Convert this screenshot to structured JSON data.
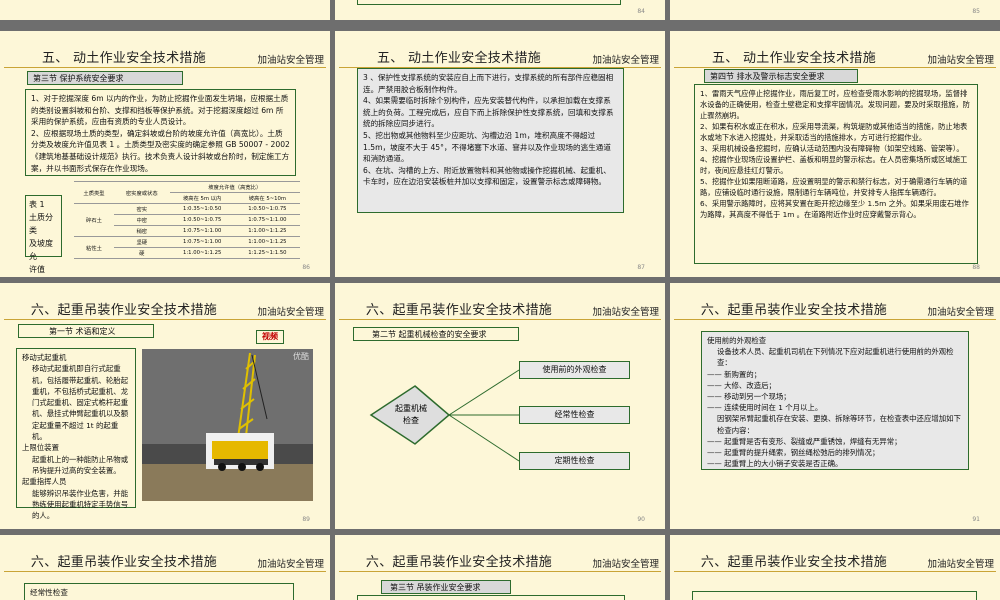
{
  "brand": "加油站安全管理",
  "top_strip": {
    "page_84": "84",
    "page_85": "85"
  },
  "slide_86": {
    "title": "五、 动土作业安全技术措施",
    "section": "第三节  保护系统安全要求",
    "text": [
      "1、对于挖掘深度 6m 以内的作业，为防止挖掘作业面发生坍塌，应根据土质的类别设置斜坡和台阶、支撑和挡板等保护系统。对于挖掘深度超过 6m 所采用的保护系统，应由有资质的专业人员设计。",
      "2、应根据现场土质的类型，确定斜坡或台阶的坡度允许值（高宽比）。土质分类及坡度允许值见表 1 。土质类型及密实度的确定参照 GB 50007 - 2002《建筑地基基础设计规范》执行。技术负责人设计斜坡或台阶时，制定施工方案，并以书面形式保存在作业现场。"
    ],
    "table_caption": [
      "表  1",
      "土质分类",
      "及坡度允",
      "许值"
    ],
    "table": {
      "h_type": "土质类型",
      "h_density": "密实度或状态",
      "h_slope": "坡度允许值（高宽比）",
      "h_d5": "坡高在 5m 以内",
      "h_d10": "坡高在 5~10m",
      "rows": [
        {
          "type": "碎石土",
          "state": "密实",
          "a": "1:0.35~1:0.50",
          "b": "1:0.50~1:0.75"
        },
        {
          "type": "",
          "state": "中密",
          "a": "1:0.50~1:0.75",
          "b": "1:0.75~1:1.00"
        },
        {
          "type": "",
          "state": "稍密",
          "a": "1:0.75~1:1.00",
          "b": "1:1.00~1:1.25"
        },
        {
          "type": "粘性土",
          "state": "坚硬",
          "a": "1:0.75~1:1.00",
          "b": "1:1.00~1:1.25"
        },
        {
          "type": "",
          "state": "硬",
          "a": "1:1.00~1:1.25",
          "b": "1:1.25~1:1.50"
        }
      ]
    },
    "page": "86"
  },
  "slide_87": {
    "title": "五、 动土作业安全技术措施",
    "text": [
      "3 、保护性支撑系统的安装应自上而下进行，支撑系统的所有部件应稳固相连。严禁用胶合板制作构件。",
      "4、如果需要临时拆除个别构件，应先安装替代构件，以承担加载在支撑系统上的负荷。工程完成后，应自下而上拆除保护性支撑系统，回填和支撑系统的拆除应同步进行。",
      "5、挖出物或其他物料至少应距坑、沟槽边沿 1m，堆积高度不得超过 1.5m，坡度不大于 45°，不得堵塞下水道、窨井以及作业现场的逃生通道和消防通道。",
      "6、在坑、沟槽的上方、附近放置物料和其他物或操作挖掘机械、起重机、卡车时，应在边沿安装板桩并加以支撑和固定，设置警示标志或障碍物。"
    ],
    "page": "87"
  },
  "slide_88": {
    "title": "五、 动土作业安全技术措施",
    "section": "第四节  排水及警示标志安全要求",
    "text": [
      "1、雷雨天气应停止挖掘作业，雨后复工时，应检查受雨水影响的挖掘现场，监督排水设备的正确使用，检查土壁稳定和支撑牢固情况。发现问题，要及时采取措施，防止骤然崩坍。",
      "2、如果有积水或正在积水，应采用导流渠，构筑堤防或其他适当的措施，防止地表水或地下水进入挖掘处，并采取适当的措施排水，方可进行挖掘作业。",
      "3、采用机械设备挖掘时，应确认活动范围内没有障碍物（如架空线路、管架等）。",
      "4、挖掘作业现场应设置护栏、盖板和明显的警示标志。在人员密集场所或区域施工时，夜间应悬挂红灯警示。",
      "5、挖掘作业如果阻断道路，应设置明显的警示和禁行标志，对于确需通行车辆的道路，应铺设临时通行设施，限制通行车辆吨位，并安排专人指挥车辆通行。",
      "6、采用警示路障时，应将其安置在距开挖边缘至少 1.5m 之外。如果采用废石堆作为路障，其高度不得低于 1m 。在道路附近作业时应穿戴警示背心。"
    ],
    "page": "88"
  },
  "slide_89": {
    "title": "六、起重吊装作业安全技术措施",
    "section": "第一节  术语和定义",
    "video_label": "视频",
    "photo_caption": "优酷",
    "text": [
      {
        "t": "移动式起重机",
        "ind": false
      },
      {
        "t": "移动式起重机即自行式起重机，包括履带起重机、轮胎起重机，不包括桥式起重机、龙门式起重机、固定式桅杆起重机、悬挂式伸臂起重机以及额定起重量不超过 1t 的起重机。",
        "ind": true
      },
      {
        "t": "上限位装置",
        "ind": false
      },
      {
        "t": "起重机上的一种能防止吊物或吊钩提升过高的安全装置。",
        "ind": true
      },
      {
        "t": "起重指挥人员",
        "ind": false
      },
      {
        "t": "能够辨识吊装作业危害，并能熟练使用起重机特定手势信号的人。",
        "ind": true
      }
    ],
    "page": "89"
  },
  "slide_90": {
    "title": "六、起重吊装作业安全技术措施",
    "section": "第二节  起重机械检查的安全要求",
    "diamond": [
      "起重机械",
      "检查"
    ],
    "items": [
      "使用前的外观检查",
      "经常性检查",
      "定期性检查"
    ],
    "page": "90"
  },
  "slide_91": {
    "title": "六、起重吊装作业安全技术措施",
    "text": [
      {
        "t": "使用前的外观检查",
        "ind": false
      },
      {
        "t": "设备技术人员、起重机司机在下列情况下应对起重机进行使用前的外观检查：",
        "ind": true
      },
      {
        "t": "—— 新购置的；",
        "ind": false
      },
      {
        "t": "—— 大修、改造后；",
        "ind": false
      },
      {
        "t": "—— 移动到另一个现场；",
        "ind": false
      },
      {
        "t": "—— 连续使用时间在 1 个月以上。",
        "ind": false
      },
      {
        "t": "因钢架吊臂起重机存在安装、更换、拆除等环节，在检查表中还应增加如下检查内容：",
        "ind": true
      },
      {
        "t": "—— 起重臂是否有变形、裂缝或严重锈蚀，焊缝有无异常；",
        "ind": false
      },
      {
        "t": "—— 起重臂的提升绳索，钢丝绳松弛后的排列情况；",
        "ind": false
      },
      {
        "t": "—— 起重臂上的大小销子安装是否正确。",
        "ind": false
      }
    ],
    "page": "91"
  },
  "slide_92": {
    "title": "六、起重吊装作业安全技术措施",
    "text_first": "经常性检查"
  },
  "slide_93": {
    "title": "六、起重吊装作业安全技术措施",
    "section": "第三节  吊装作业安全要求"
  },
  "slide_94": {
    "title": "六、起重吊装作业安全技术措施"
  }
}
